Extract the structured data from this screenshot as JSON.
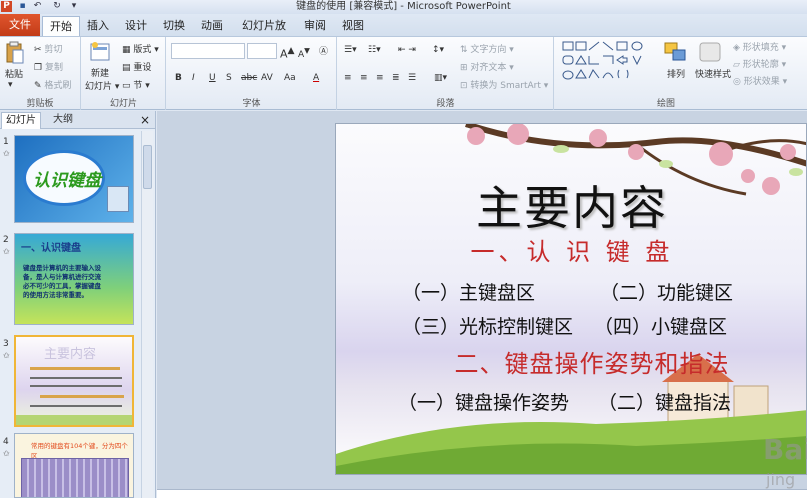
{
  "window": {
    "title": "键盘的使用 [兼容模式] - Microsoft PowerPoint",
    "app_icon": "P"
  },
  "quick_access": {
    "save_icon": "save-icon",
    "undo_icon": "undo-icon",
    "redo_icon": "redo-icon"
  },
  "tabs": [
    "文件",
    "开始",
    "插入",
    "设计",
    "切换",
    "动画",
    "幻灯片放映",
    "审阅",
    "视图"
  ],
  "ribbon": {
    "clipboard": {
      "label": "剪贴板",
      "paste": "粘贴",
      "cut": "剪切",
      "copy": "复制",
      "format_painter": "格式刷"
    },
    "slides": {
      "label": "幻灯片",
      "new_slide": "新建",
      "new_slide2": "幻灯片",
      "layout": "版式",
      "reset": "重设",
      "section": "节"
    },
    "font": {
      "label": "字体",
      "bold": "B",
      "italic": "I",
      "underline": "U",
      "shadow": "S",
      "strike": "abc",
      "spacing": "AV",
      "case": "Aa",
      "color": "A",
      "grow": "A",
      "shrink": "A"
    },
    "paragraph": {
      "label": "段落",
      "text_direction": "文字方向",
      "align_text": "对齐文本",
      "smartart": "转换为 SmartArt"
    },
    "drawing": {
      "label": "绘图",
      "arrange": "排列",
      "quick_styles": "快速样式",
      "shape_fill": "形状填充",
      "shape_outline": "形状轮廓",
      "shape_effects": "形状效果"
    }
  },
  "panel": {
    "tab_slides": "幻灯片",
    "tab_outline": "大纲",
    "close": "×",
    "thumbs": [
      {
        "num": "1",
        "text": "认识键盘"
      },
      {
        "num": "2",
        "text": "一、认识键盘",
        "body": "键盘是计算机的主要输入设备，是人与计算机进行交流必不可少的工具，掌握键盘的使用方法非常重要。"
      },
      {
        "num": "3",
        "text": "主要内容"
      },
      {
        "num": "4",
        "text": "常用的键盘有104个键，分为四个区"
      }
    ]
  },
  "slide": {
    "title": "主要内容",
    "h1": "一、认 识 键 盘",
    "items1": [
      "（一）主键盘区",
      "（二）功能键区",
      "（三）光标控制键区",
      "（四）小键盘区"
    ],
    "h2": "二、键盘操作姿势和指法",
    "items2": [
      "（一）键盘操作姿势",
      "（二）键盘指法"
    ]
  },
  "watermark": "Bai",
  "watermark2": "jing"
}
